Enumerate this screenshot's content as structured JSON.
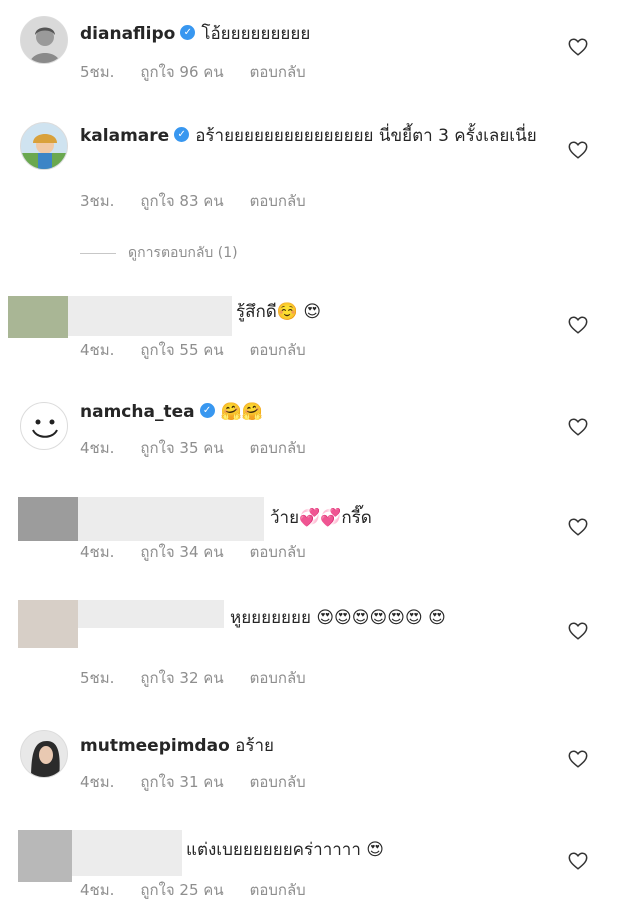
{
  "comments": [
    {
      "username": "dianaflipo",
      "verified": true,
      "text": "โอ้ยยยยยยยยย",
      "time": "5ชม.",
      "likes": "ถูกใจ 96 คน",
      "reply": "ตอบกลับ"
    },
    {
      "username": "kalamare",
      "verified": true,
      "text": "อร้ายยยยยยยยยยยยยยย นี่ขยี้ตา 3 ครั้งเลยเนี่ย",
      "time": "3ชม.",
      "likes": "ถูกใจ 83 คน",
      "reply": "ตอบกลับ"
    },
    {
      "username": "",
      "verified": false,
      "text": "รู้สึกดี☺️ 😍",
      "time": "4ชม.",
      "likes": "ถูกใจ 55 คน",
      "reply": "ตอบกลับ"
    },
    {
      "username": "namcha_tea",
      "verified": true,
      "text": "🤗🤗",
      "time": "4ชม.",
      "likes": "ถูกใจ 35 คน",
      "reply": "ตอบกลับ"
    },
    {
      "username": "",
      "verified": false,
      "text": "ว้าย💞💞กรี๊ด",
      "time": "4ชม.",
      "likes": "ถูกใจ 34 คน",
      "reply": "ตอบกลับ"
    },
    {
      "username": "",
      "verified": false,
      "text": "หูยยยยยยย 😍😍😍😍😍😍 😍",
      "time": "5ชม.",
      "likes": "ถูกใจ 32 คน",
      "reply": "ตอบกลับ"
    },
    {
      "username": "mutmeepimdao",
      "verified": false,
      "text": "อร้าย",
      "time": "4ชม.",
      "likes": "ถูกใจ 31 คน",
      "reply": "ตอบกลับ"
    },
    {
      "username": "",
      "verified": false,
      "text": "แต่งเบยยยยยยคร่าาาาา 😍",
      "time": "4ชม.",
      "likes": "ถูกใจ 25 คน",
      "reply": "ตอบกลับ"
    }
  ],
  "view_replies": "ดูการตอบกลับ (1)",
  "verified_glyph": "✓",
  "colors": {
    "verified": "#3897f0",
    "meta": "#8e8e8e",
    "text": "#262626"
  }
}
